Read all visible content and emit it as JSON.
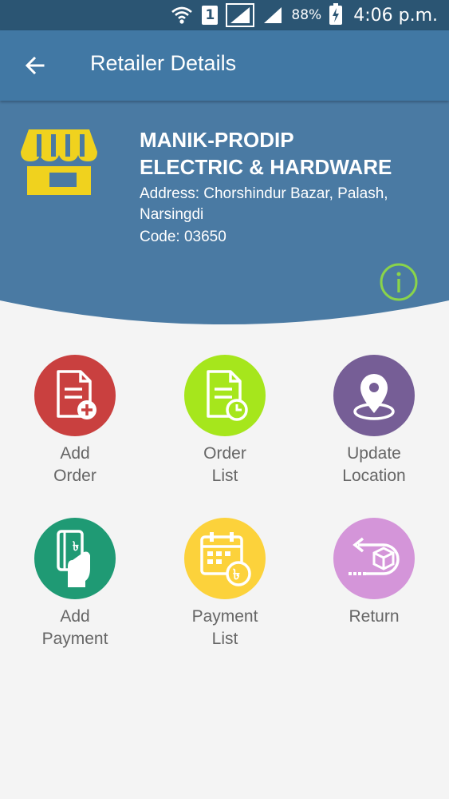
{
  "status_bar": {
    "sim": "1",
    "battery": "88%",
    "time": "4:06 p.m."
  },
  "app_bar": {
    "title": "Retailer Details"
  },
  "retailer": {
    "name_line1": "MANIK-PRODIP",
    "name_line2": "ELECTRIC & HARDWARE",
    "address_line1": "Address: Chorshindur Bazar, Palash,",
    "address_line2": "Narsingdi",
    "code": "Code: 03650"
  },
  "colors": {
    "status_bar": "#2b5573",
    "app_bar": "#4178a4",
    "header": "#4a7aa3",
    "shop_icon": "#f0d21e",
    "info_icon": "#8ad44a"
  },
  "actions": [
    {
      "line1": "Add",
      "line2": "Order",
      "color": "#c9403f",
      "icon": "document-plus-icon"
    },
    {
      "line1": "Order",
      "line2": "List",
      "color": "#a6e61c",
      "icon": "document-clock-icon"
    },
    {
      "line1": "Update",
      "line2": "Location",
      "color": "#765e96",
      "icon": "location-pin-icon"
    },
    {
      "line1": "Add",
      "line2": "Payment",
      "color": "#1f9a74",
      "icon": "hand-card-icon"
    },
    {
      "line1": "Payment",
      "line2": "List",
      "color": "#fcd23b",
      "icon": "calendar-taka-icon"
    },
    {
      "line1": "Return",
      "line2": "",
      "color": "#d495d9",
      "icon": "return-box-icon"
    }
  ]
}
